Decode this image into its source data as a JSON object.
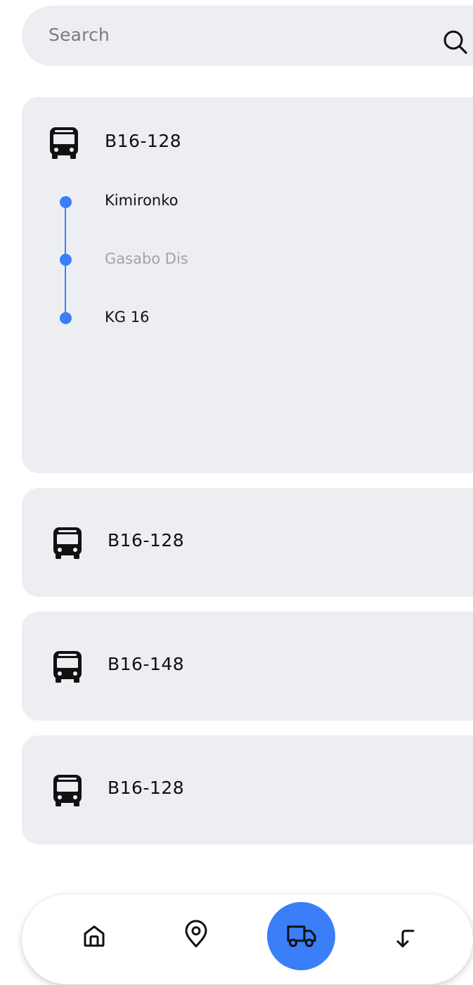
{
  "search": {
    "placeholder": "Search",
    "icon": "search-icon"
  },
  "routes": [
    {
      "name": "B16-128",
      "icon": "bus-icon",
      "expanded": true,
      "stops": [
        {
          "label": "Kimironko",
          "muted": false
        },
        {
          "label": "Gasabo Dis",
          "muted": true
        },
        {
          "label": "KG 16",
          "muted": false
        }
      ]
    },
    {
      "name": "B16-128",
      "icon": "bus-icon",
      "expanded": false
    },
    {
      "name": "B16-148",
      "icon": "bus-icon",
      "expanded": false
    },
    {
      "name": "B16-128",
      "icon": "bus-icon",
      "expanded": false
    }
  ],
  "nav": {
    "items": [
      {
        "icon": "home-icon",
        "active": false
      },
      {
        "icon": "location-pin-icon",
        "active": false
      },
      {
        "icon": "truck-icon",
        "active": true
      },
      {
        "icon": "return-arrow-icon",
        "active": false
      }
    ]
  },
  "colors": {
    "accent": "#3a7ef8",
    "card_background": "#edeef2",
    "muted_text": "#a2a2a8"
  }
}
